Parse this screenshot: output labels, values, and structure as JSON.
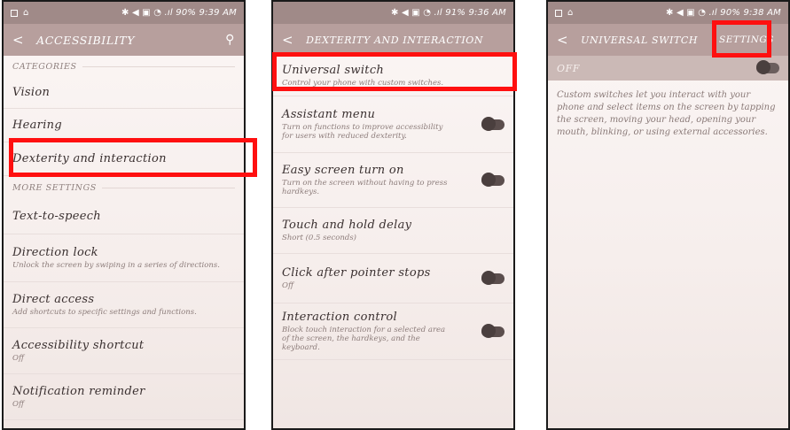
{
  "screens": [
    {
      "status_time": "90% 9:39 AM",
      "title": "ACCESSIBILITY",
      "categories_header": "CATEGORIES",
      "categories": [
        {
          "label": "Vision"
        },
        {
          "label": "Hearing"
        },
        {
          "label": "Dexterity and interaction"
        }
      ],
      "more_header": "MORE SETTINGS",
      "more_items": [
        {
          "label": "Text-to-speech",
          "sub": ""
        },
        {
          "label": "Direction lock",
          "sub": "Unlock the screen by swiping in a series of directions."
        },
        {
          "label": "Direct access",
          "sub": "Add shortcuts to specific settings and functions."
        },
        {
          "label": "Accessibility shortcut",
          "sub": "Off"
        },
        {
          "label": "Notification reminder",
          "sub": "Off"
        }
      ]
    },
    {
      "status_time": "91% 9:36 AM",
      "title": "DEXTERITY AND INTERACTION",
      "items": [
        {
          "label": "Universal switch",
          "sub": "Control your phone with custom switches."
        },
        {
          "label": "Assistant menu",
          "sub": "Turn on functions to improve accessibility for users with reduced dexterity."
        },
        {
          "label": "Easy screen turn on",
          "sub": "Turn on the screen without having to press hardkeys."
        },
        {
          "label": "Touch and hold delay",
          "sub": "Short (0.5 seconds)"
        },
        {
          "label": "Click after pointer stops",
          "sub": "Off"
        },
        {
          "label": "Interaction control",
          "sub": "Block touch interaction for a selected area of the screen, the hardkeys, and the keyboard."
        }
      ]
    },
    {
      "status_time": "90% 9:38 AM",
      "title": "UNIVERSAL SWITCH",
      "settings_label": "SETTINGS",
      "off_label": "OFF",
      "description": "Custom switches let you interact with your phone and select items on the screen by tapping the screen, moving your head, opening your mouth, blinking, or using external accessories."
    }
  ],
  "colors": {
    "highlight": "#ff1010",
    "appbar": "#b79f9d",
    "statusbar": "#a08a88"
  }
}
